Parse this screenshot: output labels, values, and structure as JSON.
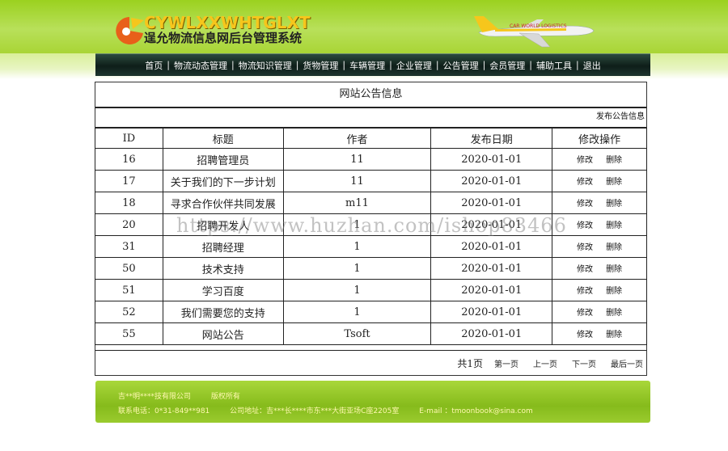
{
  "header": {
    "logo_en": "CYWLXXWHTGLXT",
    "logo_cn": "逞允物流信息网后台管理系统",
    "plane_text": "CAR WORLD LOGISTICS"
  },
  "nav": {
    "items": [
      "首页",
      "物流动态管理",
      "物流知识管理",
      "货物管理",
      "车辆管理",
      "企业管理",
      "公告管理",
      "会员管理",
      "辅助工具",
      "退出"
    ]
  },
  "panel": {
    "title": "网站公告信息",
    "publish_link": "发布公告信息",
    "columns": [
      "ID",
      "标题",
      "作者",
      "发布日期",
      "修改操作"
    ],
    "rows": [
      {
        "id": "16",
        "title": "招聘管理员",
        "author": "11",
        "date": "2020-01-01"
      },
      {
        "id": "17",
        "title": "关于我们的下一步计划",
        "author": "11",
        "date": "2020-01-01"
      },
      {
        "id": "18",
        "title": "寻求合作伙伴共同发展",
        "author": "m11",
        "date": "2020-01-01"
      },
      {
        "id": "20",
        "title": "招聘开发人",
        "author": "1",
        "date": "2020-01-01"
      },
      {
        "id": "31",
        "title": "招聘经理",
        "author": "1",
        "date": "2020-01-01"
      },
      {
        "id": "50",
        "title": "技术支持",
        "author": "1",
        "date": "2020-01-01"
      },
      {
        "id": "51",
        "title": "学习百度",
        "author": "1",
        "date": "2020-01-01"
      },
      {
        "id": "52",
        "title": "我们需要您的支持",
        "author": "1",
        "date": "2020-01-01"
      },
      {
        "id": "55",
        "title": "网站公告",
        "author": "Tsoft",
        "date": "2020-01-01"
      }
    ],
    "edit_label": "修改",
    "delete_label": "删除",
    "pager": {
      "total": "共1页",
      "first": "第一页",
      "prev": "上一页",
      "next": "下一页",
      "last": "最后一页"
    }
  },
  "watermark": "https://www.huzhan.com/ishop83466",
  "footer": {
    "company": "吉**明****技有限公司",
    "rights": "版权所有",
    "phone": "联系电话：0*31-849**981",
    "address": "公司地址：吉***长****市东***大街亚场C座2205室",
    "email": "E-mail  ：tmoonbook@sina.com"
  },
  "colors": {
    "header_green": "#9bd11f",
    "nav_dark": "#0e1e19",
    "footer_green": "#86bb1c",
    "footer_text": "#fff8b0"
  }
}
